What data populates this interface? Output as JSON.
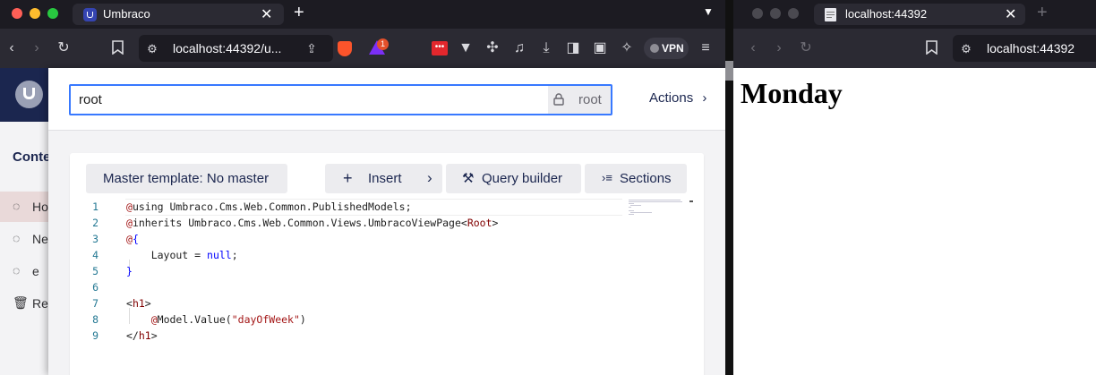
{
  "left_browser": {
    "tab_title": "Umbraco",
    "url": "localhost:44392/u...",
    "vpn_label": "VPN",
    "brave_badge": "1"
  },
  "umbraco": {
    "sidebar_header": "Conte",
    "sidebar_items": [
      {
        "label": "Ho",
        "icon": "circle-dashed-icon"
      },
      {
        "label": "Ne",
        "icon": "circle-dashed-icon"
      },
      {
        "label": "e",
        "icon": "circle-dashed-icon"
      },
      {
        "label": "Rec",
        "icon": "trash-icon"
      }
    ]
  },
  "editor": {
    "name_value": "root",
    "alias_value": "root",
    "actions_label": "Actions",
    "master_template_label": "Master template: No master",
    "insert_label": "Insert",
    "query_builder_label": "Query builder",
    "sections_label": "Sections",
    "code_lines": [
      {
        "num": "1",
        "parts": [
          {
            "c": "k-at",
            "t": "@"
          },
          {
            "c": "k-txt",
            "t": "using Umbraco.Cms.Web.Common.PublishedModels;"
          }
        ]
      },
      {
        "num": "2",
        "parts": [
          {
            "c": "k-at",
            "t": "@"
          },
          {
            "c": "k-txt",
            "t": "inherits Umbraco.Cms.Web.Common.Views.UmbracoViewPage<"
          },
          {
            "c": "k-tag",
            "t": "Root"
          },
          {
            "c": "k-txt",
            "t": ">"
          }
        ]
      },
      {
        "num": "3",
        "parts": [
          {
            "c": "k-at",
            "t": "@"
          },
          {
            "c": "k-kw",
            "t": "{"
          }
        ]
      },
      {
        "num": "4",
        "parts": [
          {
            "c": "k-txt",
            "t": "    Layout = "
          },
          {
            "c": "k-kw",
            "t": "null"
          },
          {
            "c": "k-txt",
            "t": ";"
          }
        ]
      },
      {
        "num": "5",
        "parts": [
          {
            "c": "k-kw",
            "t": "}"
          }
        ]
      },
      {
        "num": "6",
        "parts": []
      },
      {
        "num": "7",
        "parts": [
          {
            "c": "k-txt",
            "t": "<"
          },
          {
            "c": "k-tag",
            "t": "h1"
          },
          {
            "c": "k-txt",
            "t": ">"
          }
        ]
      },
      {
        "num": "8",
        "parts": [
          {
            "c": "k-txt",
            "t": "    "
          },
          {
            "c": "k-at",
            "t": "@"
          },
          {
            "c": "k-txt",
            "t": "Model.Value("
          },
          {
            "c": "k-str",
            "t": "\"dayOfWeek\""
          },
          {
            "c": "k-txt",
            "t": ")"
          }
        ]
      },
      {
        "num": "9",
        "parts": [
          {
            "c": "k-txt",
            "t": "</"
          },
          {
            "c": "k-tag",
            "t": "h1"
          },
          {
            "c": "k-txt",
            "t": ">"
          }
        ]
      }
    ]
  },
  "right_browser": {
    "tab_title": "localhost:44392",
    "url": "localhost:44392",
    "page_heading": "Monday"
  },
  "colors": {
    "umbraco_navy": "#1b264f",
    "focus_blue": "#3879ff",
    "browser_dark": "#1c1b22",
    "toolbar_dark": "#2b2a33"
  }
}
